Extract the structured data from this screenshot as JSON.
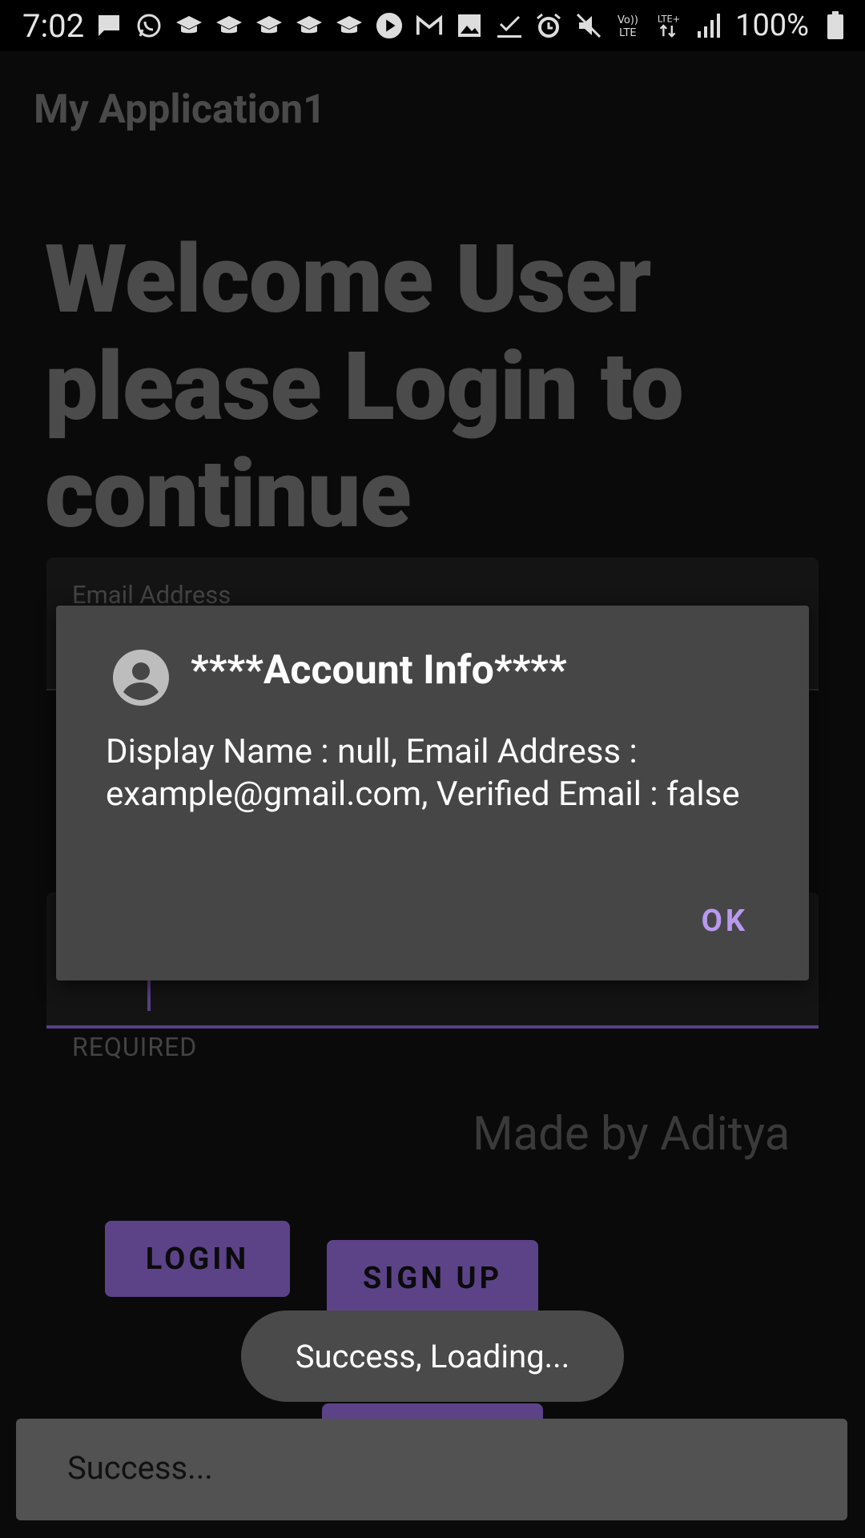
{
  "status_bar": {
    "time": "7:02",
    "battery": "100%",
    "left_icons": [
      "message-icon",
      "whatsapp-icon",
      "school-icon",
      "school-icon",
      "school-icon",
      "school-icon",
      "school-icon",
      "play-icon",
      "gmail-icon",
      "image-icon",
      "checkmark-icon"
    ],
    "right_icons": [
      "alarm-icon",
      "mute-icon",
      "volte-icon",
      "lte-plus-icon",
      "signal-icon",
      "battery-icon"
    ]
  },
  "app": {
    "title": "My Application1"
  },
  "login": {
    "welcome_text": "Welcome User please Login to continue",
    "email_label": "Email Address",
    "password_helper": "REQUIRED",
    "made_by": "Made by Aditya",
    "login_button": "LOGIN",
    "signup_button": "SIGN UP"
  },
  "dialog": {
    "title": "****Account Info****",
    "message": "Display Name : null, Email Address : example@gmail.com, Verified Email : false",
    "ok_button": "OK"
  },
  "toast": {
    "text": "Success, Loading..."
  },
  "snackbar": {
    "text": "Success..."
  },
  "colors": {
    "accent": "#b999f0",
    "button": "#5c4388",
    "dialog_bg": "#464646"
  }
}
